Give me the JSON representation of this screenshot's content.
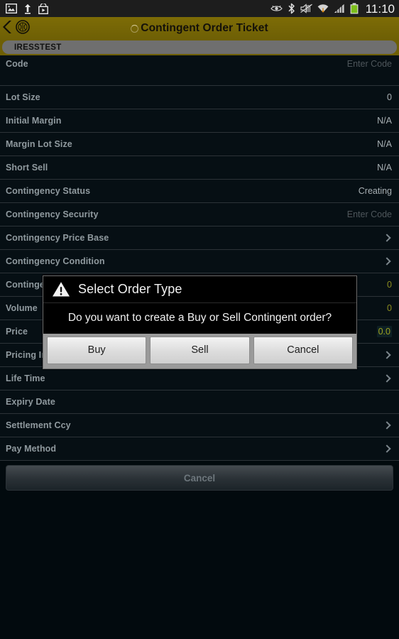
{
  "statusbar": {
    "time": "11:10",
    "left_icons": [
      "image-icon",
      "upload-icon",
      "play-store-icon"
    ],
    "right_icons": [
      "eye-icon",
      "bluetooth-icon",
      "mute-icon",
      "wifi-icon",
      "signal-icon",
      "battery-icon"
    ]
  },
  "actionbar": {
    "title": "Contingent Order Ticket",
    "back_icon": "back-chevron-icon",
    "app_icon": "app-logo-icon",
    "spinner_icon": "loading-spinner-icon",
    "bg_color": "#6e5f05",
    "title_color": "#14110a"
  },
  "account_tab": {
    "label": "IRESSTEST"
  },
  "form": {
    "rows": [
      {
        "label": "Code",
        "value": "Enter Code",
        "style": "hint",
        "tall": true,
        "chevron": false
      },
      {
        "label": "Lot Size",
        "value": "0",
        "style": "plain",
        "tall": false,
        "chevron": false
      },
      {
        "label": "Initial Margin",
        "value": "N/A",
        "style": "plain",
        "tall": false,
        "chevron": false
      },
      {
        "label": "Margin Lot Size",
        "value": "N/A",
        "style": "plain",
        "tall": false,
        "chevron": false
      },
      {
        "label": "Short Sell",
        "value": "N/A",
        "style": "plain",
        "tall": false,
        "chevron": false
      },
      {
        "label": "Contingency Status",
        "value": "Creating",
        "style": "plain",
        "tall": false,
        "chevron": false
      },
      {
        "label": "Contingency Security",
        "value": "Enter Code",
        "style": "hint",
        "tall": false,
        "chevron": false
      },
      {
        "label": "Contingency Price Base",
        "value": "",
        "style": "plain",
        "tall": false,
        "chevron": true
      },
      {
        "label": "Contingency Condition",
        "value": "",
        "style": "plain",
        "tall": false,
        "chevron": true
      },
      {
        "label": "Contingency Trigger Price",
        "value": "0",
        "style": "num",
        "tall": false,
        "chevron": false
      },
      {
        "label": "Volume",
        "value": "0",
        "style": "num",
        "tall": false,
        "chevron": false
      },
      {
        "label": "Price",
        "value": "0.0",
        "style": "focus",
        "tall": false,
        "chevron": false
      },
      {
        "label": "Pricing Instruction",
        "value": "",
        "style": "plain",
        "tall": false,
        "chevron": true
      },
      {
        "label": "Life Time",
        "value": "",
        "style": "plain",
        "tall": false,
        "chevron": true
      },
      {
        "label": "Expiry Date",
        "value": "",
        "style": "plain",
        "tall": false,
        "chevron": false
      },
      {
        "label": "Settlement Ccy",
        "value": "",
        "style": "plain",
        "tall": false,
        "chevron": true
      },
      {
        "label": "Pay Method",
        "value": "",
        "style": "plain",
        "tall": false,
        "chevron": true
      }
    ],
    "cancel_label": "Cancel"
  },
  "dialog": {
    "icon": "warning-triangle-icon",
    "title": "Select Order Type",
    "message": "Do you want to create a Buy or Sell Contingent order?",
    "buttons": [
      {
        "label": "Buy"
      },
      {
        "label": "Sell"
      },
      {
        "label": "Cancel"
      }
    ]
  }
}
